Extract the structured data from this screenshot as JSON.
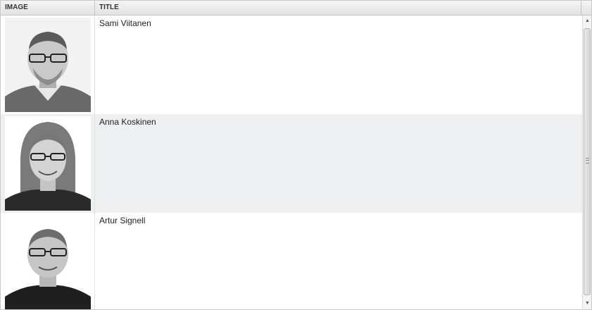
{
  "columns": {
    "image": "IMAGE",
    "title": "TITLE"
  },
  "rows": [
    {
      "title": "Sami Viitanen",
      "photo": "person-photo"
    },
    {
      "title": "Anna Koskinen",
      "photo": "person-photo"
    },
    {
      "title": "Artur Signell",
      "photo": "person-photo"
    }
  ],
  "scrollbar": {
    "up_icon": "chevron-up-icon",
    "down_icon": "chevron-down-icon"
  },
  "colors": {
    "row_alt": "#eeeff1",
    "header": "#e2e3e5",
    "border": "#c7c8ca"
  }
}
